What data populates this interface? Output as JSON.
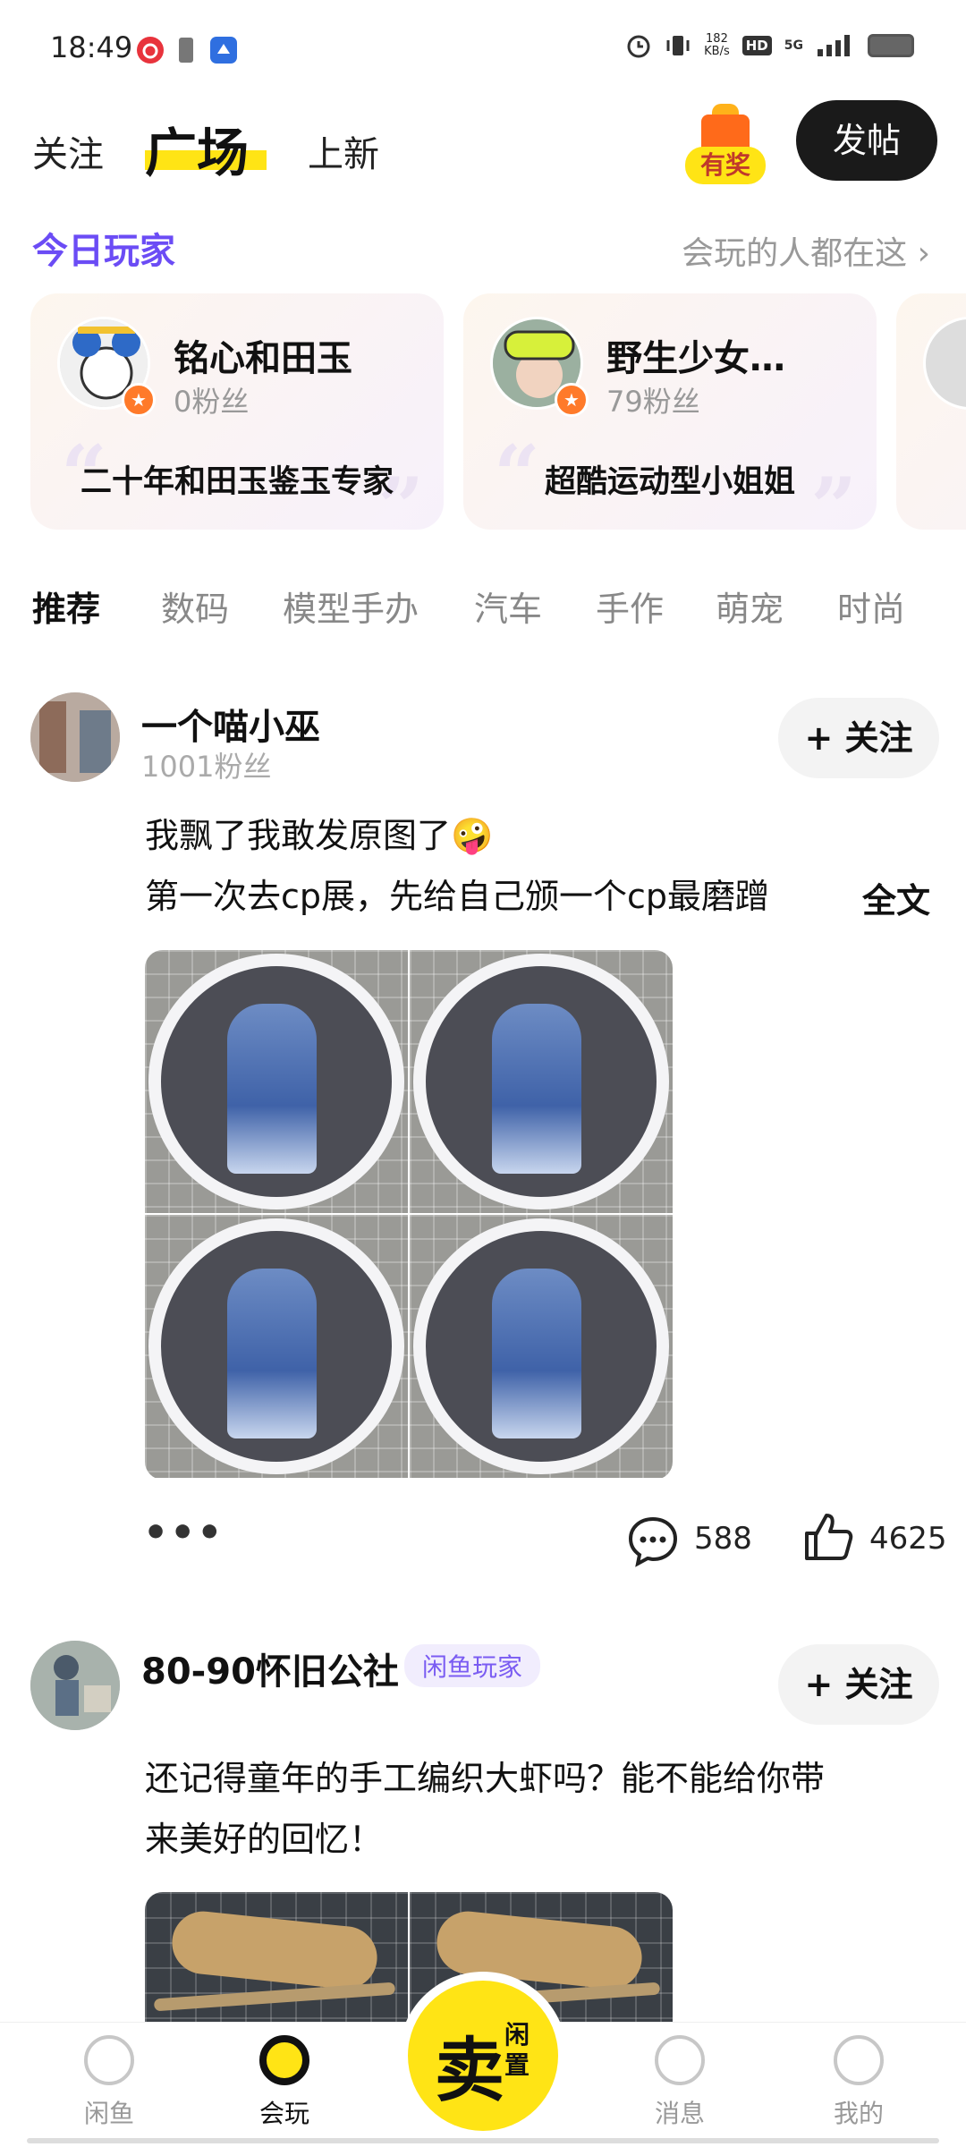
{
  "status_bar": {
    "time": "18:49",
    "net_speed_value": "182",
    "net_speed_unit": "KB/s",
    "hd": "HD",
    "network": "5G"
  },
  "header": {
    "tabs": [
      "关注",
      "广场",
      "上新"
    ],
    "active_tab": "广场",
    "gift_label": "有奖",
    "post_button": "发帖"
  },
  "players": {
    "title": "今日玩家",
    "more": "会玩的人都在这 ›",
    "cards": [
      {
        "name": "铭心和田玉",
        "fans": "0粉丝",
        "desc": "二十年和田玉鉴玉专家"
      },
      {
        "name": "野生少女…",
        "fans": "79粉丝",
        "desc": "超酷运动型小姐姐"
      }
    ]
  },
  "categories": [
    "推荐",
    "数码",
    "模型手办",
    "汽车",
    "手作",
    "萌宠",
    "时尚"
  ],
  "feed": [
    {
      "author": "一个喵小巫",
      "fans": "1001粉丝",
      "follow_label": "+ 关注",
      "text_line1": "我飘了我敢发原图了🤪",
      "text_line2": "第一次去cp展，先给自己颁一个cp最磨蹭",
      "fulltext_label": "全文",
      "more_label": "•••",
      "comments": "588",
      "likes": "4625"
    },
    {
      "author": "80-90怀旧公社",
      "tag": "闲鱼玩家",
      "follow_label": "+ 关注",
      "text_line1": "还记得童年的手工编织大虾吗？能不能给你带",
      "text_line2": "来美好的回忆！"
    }
  ],
  "bottom_nav": {
    "items": [
      "闲鱼",
      "会玩",
      "消息",
      "我的"
    ],
    "active": "会玩",
    "sell_main": "卖",
    "sell_sub": "闲置"
  },
  "colors": {
    "accent_yellow": "#ffe415",
    "purple": "#6b4cf5"
  }
}
